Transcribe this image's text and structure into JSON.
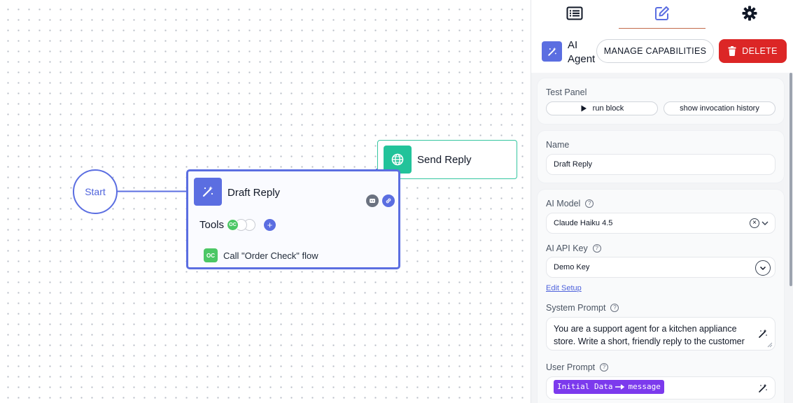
{
  "canvas": {
    "start_node": {
      "label": "Start"
    },
    "send_node": {
      "label": "Send Reply",
      "icon": "globe-icon"
    },
    "draft_node": {
      "title": "Draft Reply",
      "icon": "magic-wand-icon",
      "tools_label": "Tools",
      "tool_chip": "OC",
      "add_tool": "+",
      "tool_item": {
        "chip": "OC",
        "label": "Call \"Order Check\" flow"
      }
    }
  },
  "panel": {
    "tabs": [
      {
        "icon": "list-icon"
      },
      {
        "icon": "edit-icon",
        "active": true
      },
      {
        "icon": "gear-icon"
      }
    ],
    "header": {
      "title": "AI Agent",
      "manage_label": "MANAGE CAPABILITIES",
      "delete_label": "DELETE"
    },
    "test_panel": {
      "label": "Test Panel",
      "run_label": "run block",
      "history_label": "show invocation history"
    },
    "name": {
      "label": "Name",
      "value": "Draft Reply"
    },
    "ai_model": {
      "label": "AI Model",
      "help": "?",
      "value": "Claude Haiku 4.5",
      "clear": "×"
    },
    "ai_api_key": {
      "label": "AI API Key",
      "help": "?",
      "value": "Demo Key",
      "edit_link": "Edit Setup"
    },
    "system_prompt": {
      "label": "System Prompt",
      "help": "?",
      "value": "You are a support agent for a kitchen appliance store. Write a short, friendly reply to the customer message. If they"
    },
    "user_prompt": {
      "label": "User Prompt",
      "help": "?",
      "token_source": "Initial Data",
      "token_field": "message"
    }
  },
  "colors": {
    "accent": "#5b6ee1",
    "send_green": "#22c39a",
    "delete_red": "#dc2626",
    "token_purple": "#7c3aed",
    "tool_green": "#4cc765"
  }
}
